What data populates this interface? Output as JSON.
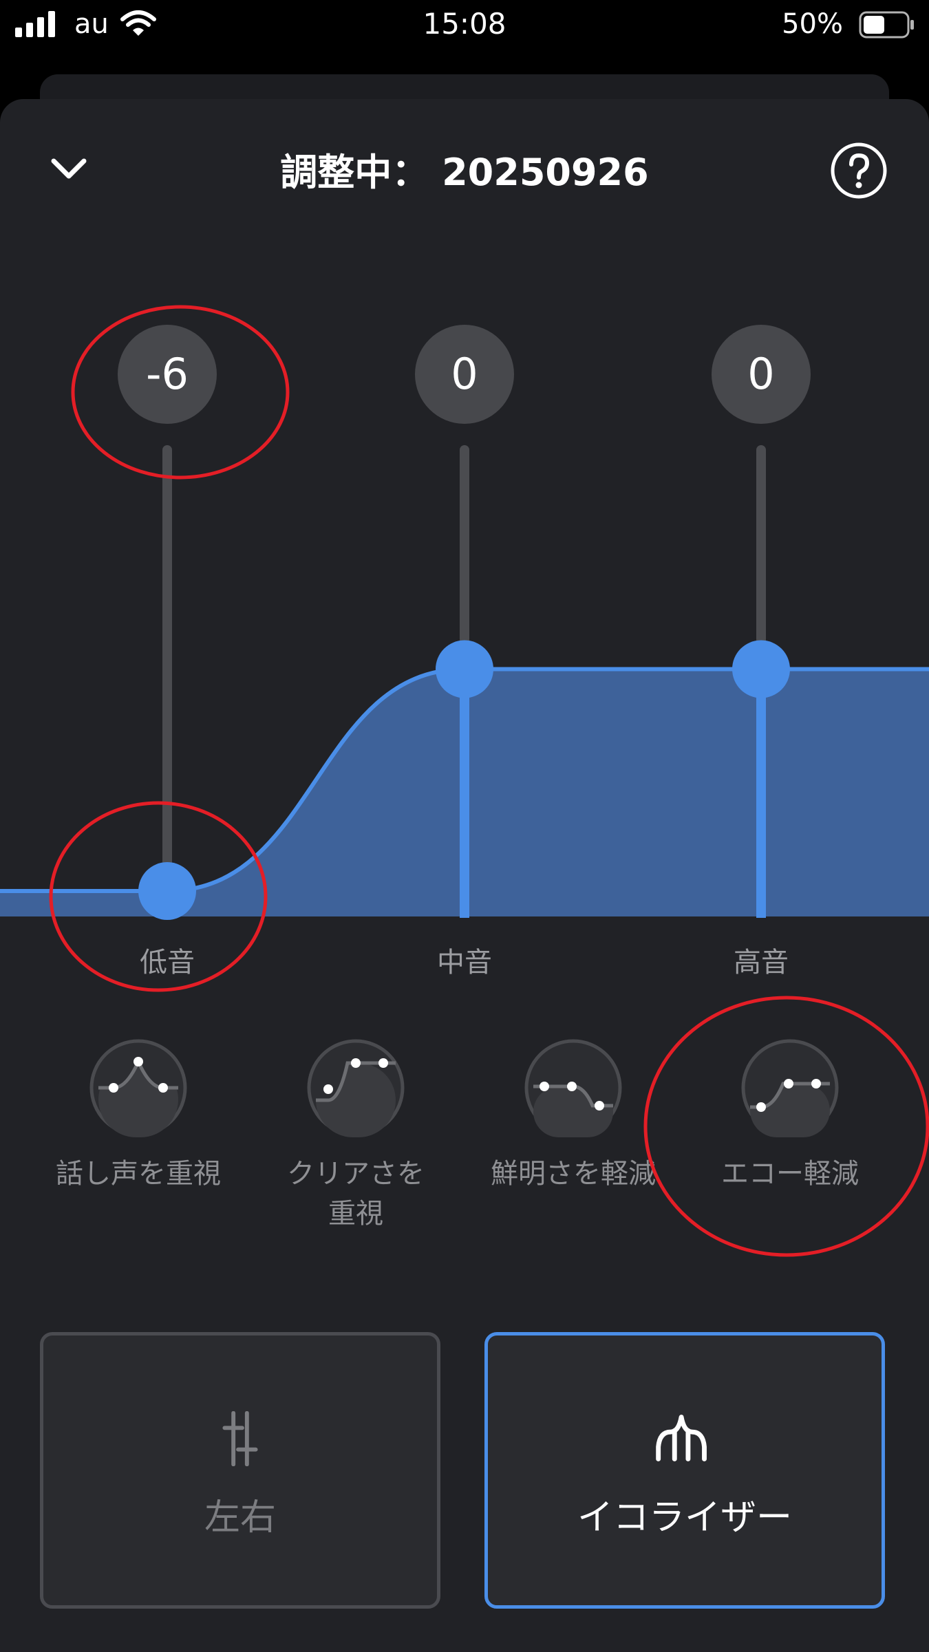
{
  "status_bar": {
    "carrier": "au",
    "time": "15:08",
    "battery": "50%",
    "battery_level": 0.5
  },
  "header": {
    "title": "調整中： 20250926"
  },
  "equalizer": {
    "range": [
      -6,
      6
    ],
    "bands": [
      {
        "label": "低音",
        "value": -6,
        "value_text": "-6"
      },
      {
        "label": "中音",
        "value": 0,
        "value_text": "0"
      },
      {
        "label": "高音",
        "value": 0,
        "value_text": "0"
      }
    ]
  },
  "presets": [
    {
      "label": "話し声を重視",
      "icon": "curve-peak-icon"
    },
    {
      "label": "クリアさを\n重視",
      "icon": "curve-rise-high-icon"
    },
    {
      "label": "鮮明さを軽減",
      "icon": "curve-fall-icon"
    },
    {
      "label": "エコー軽減",
      "icon": "curve-rise-icon"
    }
  ],
  "modes": [
    {
      "label": "左右",
      "icon": "sliders-icon",
      "selected": false
    },
    {
      "label": "イコライザー",
      "icon": "equalizer-icon",
      "selected": true
    }
  ],
  "colors": {
    "accent": "#4a8ee8",
    "background": "#212226",
    "fill": "#3e629a",
    "annotation": "#e41e26"
  }
}
